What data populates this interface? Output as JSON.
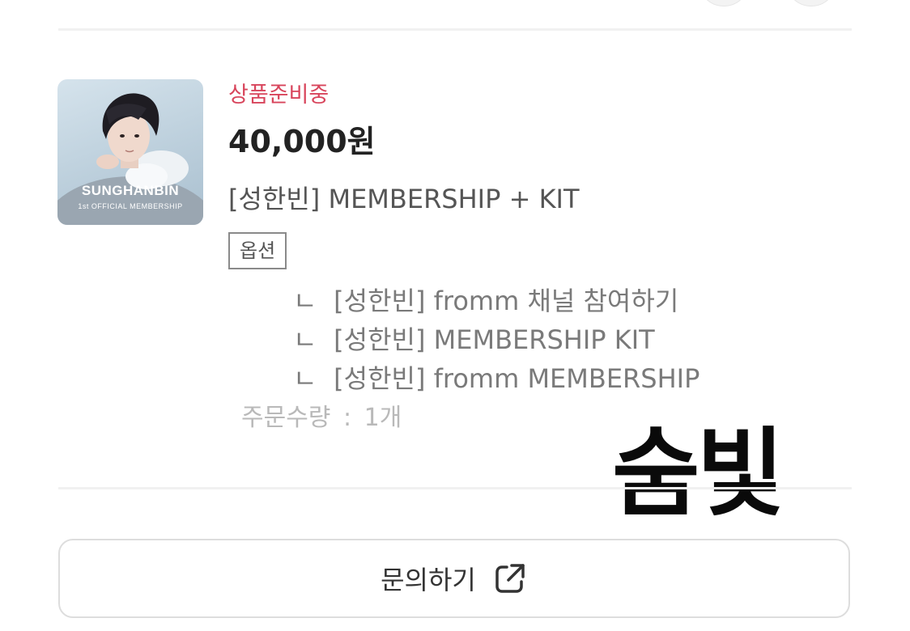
{
  "thumbnail": {
    "name": "SUNGHANBIN",
    "subtitle": "1st OFFICIAL MEMBERSHIP"
  },
  "order": {
    "status": "상품준비중",
    "price": "40,000원",
    "product_name": "[성한빈] MEMBERSHIP + KIT",
    "option_label": "옵션",
    "option_marker": "ㄴ",
    "options": [
      "[성한빈] fromm 채널 참여하기",
      "[성한빈] MEMBERSHIP KIT",
      "[성한빈] fromm MEMBERSHIP"
    ],
    "quantity_label": "주문수량",
    "quantity_separator": ":",
    "quantity_value": "1개"
  },
  "watermark": "숨빛",
  "inquiry": {
    "label": "문의하기",
    "icon": "external-link-icon"
  },
  "colors": {
    "status": "#d8455c",
    "text": "#222222",
    "muted": "#7a7a7a",
    "quantity": "#b9b9b9",
    "border": "#dddddd"
  }
}
